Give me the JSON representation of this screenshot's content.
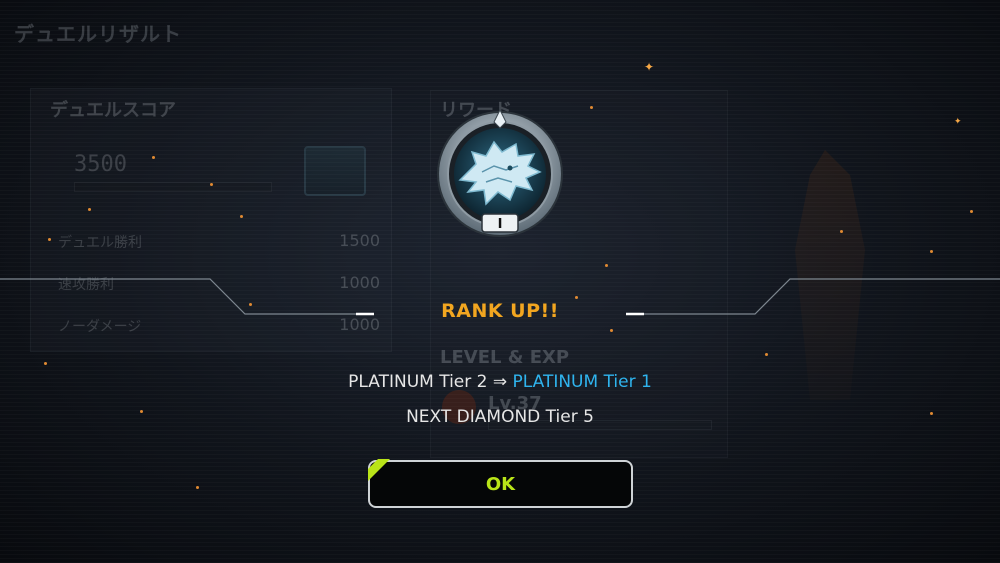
{
  "background_screen": {
    "title": "デュエルリザルト",
    "score_panel_label": "デュエルスコア",
    "score_value": "3500",
    "rows": [
      {
        "label": "デュエル勝利",
        "value": "1500"
      },
      {
        "label": "速攻勝利",
        "value": "1000"
      },
      {
        "label": "ノーダメージ",
        "value": "1000"
      }
    ],
    "reward_label": "リワード",
    "level_label": "LEVEL & EXP",
    "level_value": "Lv.37"
  },
  "dialog": {
    "badge_tier_numeral": "I",
    "title": "RANK UP!!",
    "tier_from": "PLATINUM Tier 2 ⇒ ",
    "tier_to": "PLATINUM Tier 1",
    "next_text": "NEXT DIAMOND Tier 5",
    "ok_label": "OK"
  },
  "colors": {
    "title_orange": "#f2a620",
    "tier_to_blue": "#2fb4ee",
    "ok_green": "#b9e418"
  }
}
